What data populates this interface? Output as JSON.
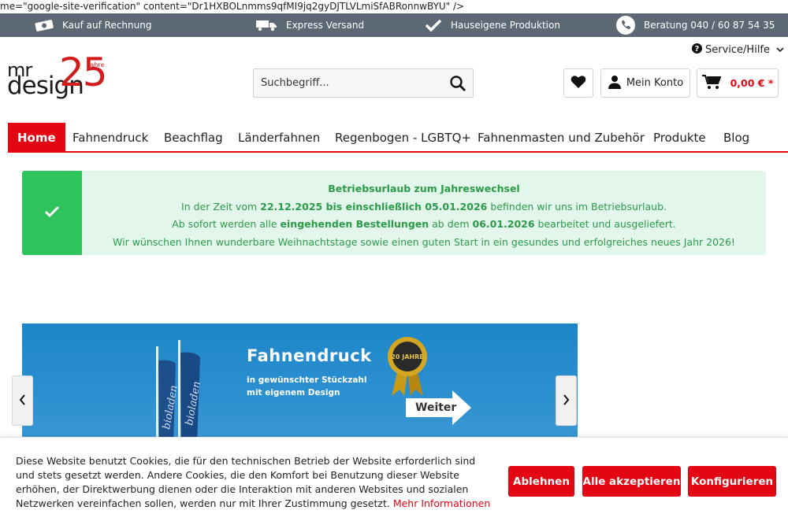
{
  "leak_text": "me=\"google-site-verification\" content=\"Dr1HXBOLnmms9qfMI9jq2gyDJTLVLmiSfABRonnwBYU\" />",
  "topbar": {
    "items": [
      {
        "label": "Kauf auf Rechnung",
        "icon": "money-icon"
      },
      {
        "label": "Express Versand",
        "icon": "truck-icon"
      },
      {
        "label": "Hauseigene Produktion",
        "icon": "checkmark-icon"
      },
      {
        "label": "Beratung 040 / 60 87 54 35",
        "icon": "phone-icon"
      }
    ]
  },
  "logo": {
    "mr": "mr",
    "design": "design",
    "number": "25",
    "jahre": "Jahre"
  },
  "service": {
    "label": "Service/Hilfe"
  },
  "search": {
    "placeholder": "Suchbegriff..."
  },
  "account": {
    "label": "Mein Konto"
  },
  "cart": {
    "total": "0,00 € *"
  },
  "nav": {
    "items": [
      "Home",
      "Fahnendruck",
      "Beachflag",
      "Länderfahnen",
      "Regenbogen - LGBTQ+",
      "Fahnenmasten und Zubehör",
      "Produkte",
      "Blog"
    ]
  },
  "alert": {
    "title": "Betriebsurlaub zum Jahreswechsel",
    "line1_a": "In der Zeit vom ",
    "line1_b": "22.12.2025 bis einschließlich 05.01.2026",
    "line1_c": " befinden wir uns im Betriebsurlaub.",
    "line2_a": "Ab sofort werden alle ",
    "line2_b": "eingehenden Bestellungen",
    "line2_c": " ab dem ",
    "line2_d": "06.01.2026",
    "line2_e": " bearbeitet und ausgeliefert.",
    "line3": "Wir wünschen Ihnen wunderbare Weihnachtstage sowie einen guten Start in ein gesundes und erfolgreiches neues Jahr 2026!"
  },
  "slider": {
    "title": "Fahnendruck",
    "sub1": "in gewünschter Stückzahl",
    "sub2": "mit eigenem Design",
    "button": "Weiter",
    "seal_text": "20 JAHRE",
    "flag_text": "bioladen"
  },
  "cookie": {
    "text": "Diese Website benutzt Cookies, die für den technischen Betrieb der Website erforderlich sind und stets gesetzt werden. Andere Cookies, die den Komfort bei Benutzung dieser Website erhöhen, der Direktwerbung dienen oder die Interaktion mit anderen Websites und sozialen Netzwerken vereinfachen sollen, werden nur mit Ihrer Zustimmung gesetzt. ",
    "link": "Mehr Informationen",
    "buttons": {
      "decline": "Ablehnen",
      "accept_all": "Alle akzeptieren",
      "configure": "Konfigurieren"
    }
  },
  "colors": {
    "brand_red": "#e30613",
    "topbar": "#5c6873",
    "alert_green": "#2ec45b",
    "alert_bg": "#e3f6ec",
    "alert_text": "#2c9b48",
    "slider_blue": "#1d86c8"
  }
}
